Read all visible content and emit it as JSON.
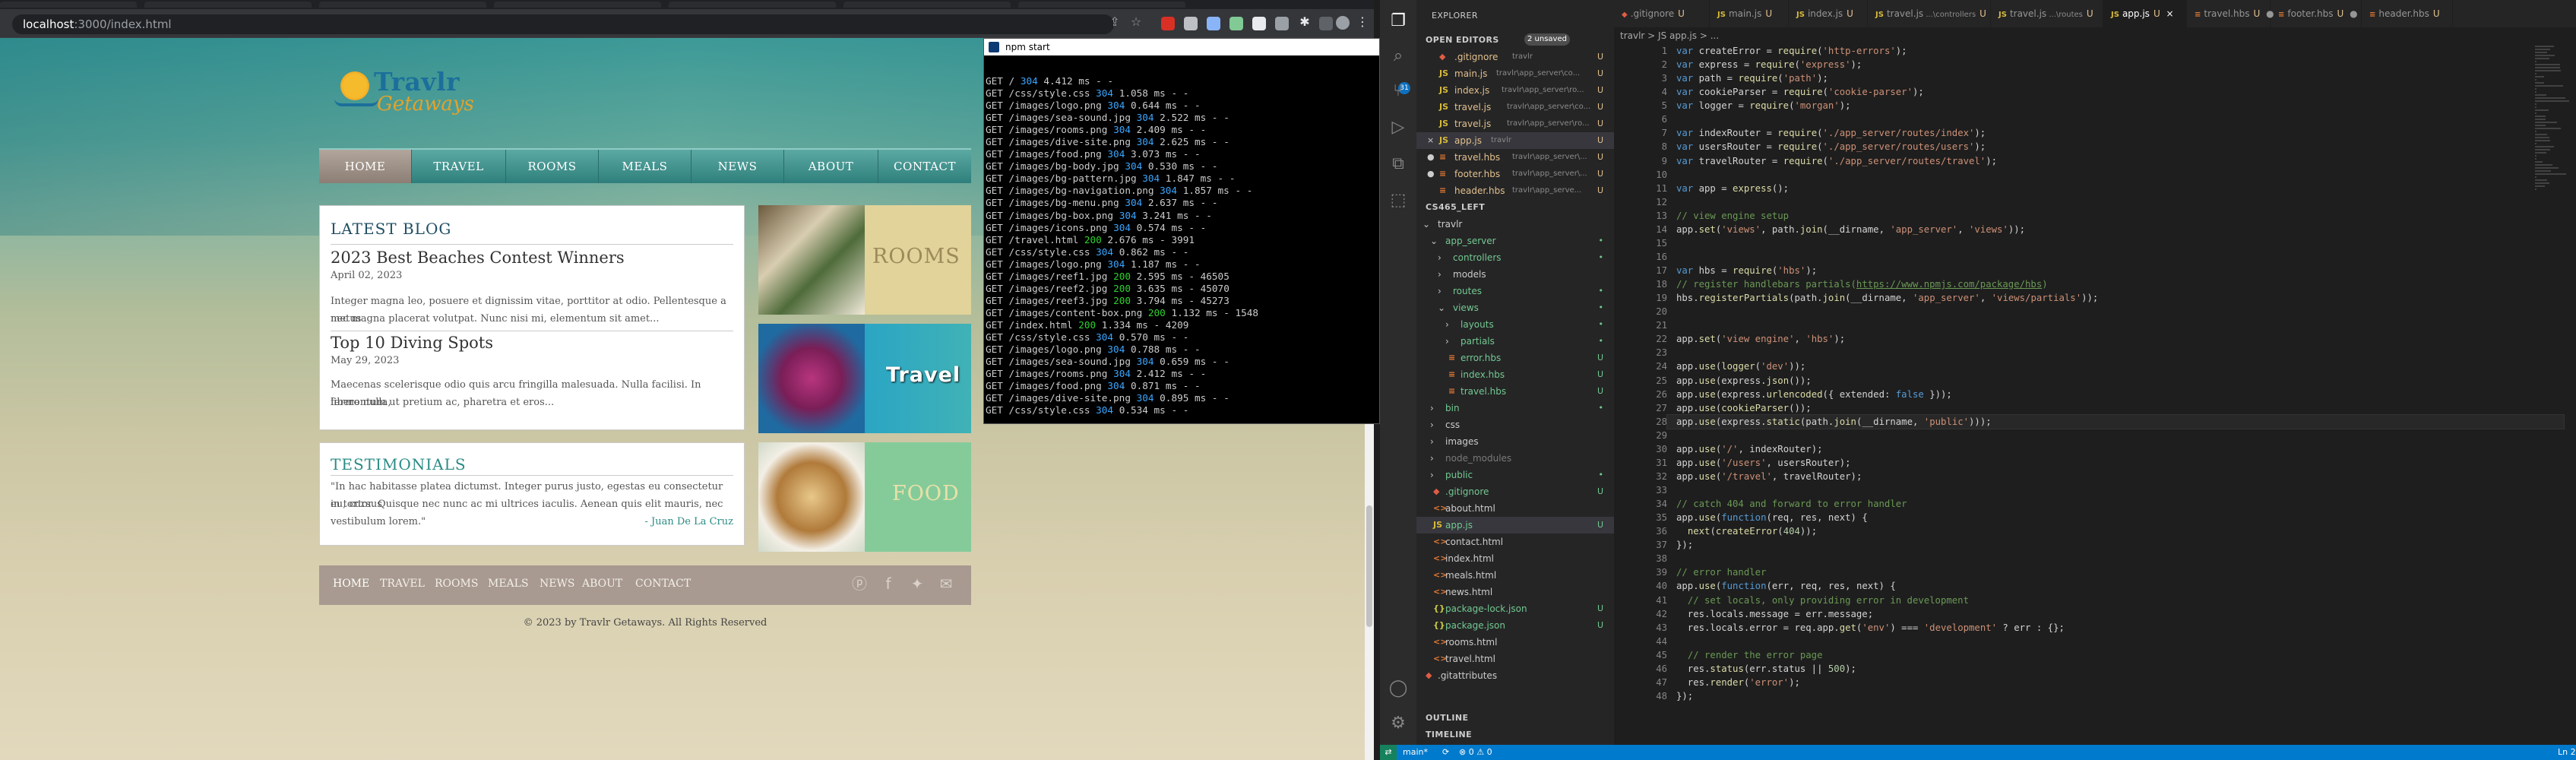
{
  "browser": {
    "url_host": "localhost",
    "url_path": ":3000/index.html"
  },
  "site": {
    "logo_word1": "Travlr",
    "logo_word2": "Getaways",
    "nav": [
      "HOME",
      "TRAVEL",
      "ROOMS",
      "MEALS",
      "NEWS",
      "ABOUT",
      "CONTACT"
    ],
    "nav_active": "HOME",
    "blog": {
      "heading": "LATEST BLOG",
      "posts": [
        {
          "title": "2023 Best Beaches Contest Winners",
          "date": "April 02, 2023",
          "body1": "Integer magna leo, posuere et dignissim vitae, porttitor at odio. Pellentesque a metus",
          "body2": "nec magna placerat volutpat. Nunc nisi mi, elementum sit amet..."
        },
        {
          "title": "Top 10 Diving Spots",
          "date": "May 29, 2023",
          "body1": "Maecenas scelerisque odio quis arcu fringilla malesuada. Nulla facilisi. In libero nulla,",
          "body2": "fermentum ut pretium ac, pharetra et eros..."
        }
      ]
    },
    "testimonials": {
      "heading": "TESTIMONIALS",
      "quote1": "\"In hac habitasse platea dictumst. Integer purus justo, egestas eu consectetur eu, cursus",
      "quote2": "in tortor. Quisque nec nunc ac mi ultrices iaculis. Aenean quis elit mauris, nec",
      "quote3": "vestibulum lorem.\"",
      "author": "- Juan De La Cruz"
    },
    "promos": [
      "ROOMS",
      "Travel",
      "FOOD"
    ],
    "footer_nav": [
      "HOME",
      "TRAVEL",
      "ROOMS",
      "MEALS",
      "NEWS",
      "ABOUT",
      "CONTACT"
    ],
    "copyright": "© 2023 by Travlr Getaways. All Rights Reserved"
  },
  "terminal": {
    "title": "npm start",
    "lines": [
      {
        "m": "GET",
        "p": "/",
        "c": "304",
        "t": "4.412 ms - -"
      },
      {
        "m": "GET",
        "p": "/css/style.css",
        "c": "304",
        "t": "1.058 ms - -"
      },
      {
        "m": "GET",
        "p": "/images/logo.png",
        "c": "304",
        "t": "0.644 ms - -"
      },
      {
        "m": "GET",
        "p": "/images/sea-sound.jpg",
        "c": "304",
        "t": "2.522 ms - -"
      },
      {
        "m": "GET",
        "p": "/images/rooms.png",
        "c": "304",
        "t": "2.409 ms - -"
      },
      {
        "m": "GET",
        "p": "/images/dive-site.png",
        "c": "304",
        "t": "2.625 ms - -"
      },
      {
        "m": "GET",
        "p": "/images/food.png",
        "c": "304",
        "t": "3.073 ms - -"
      },
      {
        "m": "GET",
        "p": "/images/bg-body.jpg",
        "c": "304",
        "t": "0.530 ms - -"
      },
      {
        "m": "GET",
        "p": "/images/bg-pattern.jpg",
        "c": "304",
        "t": "1.847 ms - -"
      },
      {
        "m": "GET",
        "p": "/images/bg-navigation.png",
        "c": "304",
        "t": "1.857 ms - -"
      },
      {
        "m": "GET",
        "p": "/images/bg-menu.png",
        "c": "304",
        "t": "2.637 ms - -"
      },
      {
        "m": "GET",
        "p": "/images/bg-box.png",
        "c": "304",
        "t": "3.241 ms - -"
      },
      {
        "m": "GET",
        "p": "/images/icons.png",
        "c": "304",
        "t": "0.574 ms - -"
      },
      {
        "m": "GET",
        "p": "/travel.html",
        "c": "200",
        "t": "2.676 ms - 3991"
      },
      {
        "m": "GET",
        "p": "/css/style.css",
        "c": "304",
        "t": "0.862 ms - -"
      },
      {
        "m": "GET",
        "p": "/images/logo.png",
        "c": "304",
        "t": "1.187 ms - -"
      },
      {
        "m": "GET",
        "p": "/images/reef1.jpg",
        "c": "200",
        "t": "2.595 ms - 46505"
      },
      {
        "m": "GET",
        "p": "/images/reef2.jpg",
        "c": "200",
        "t": "3.635 ms - 45070"
      },
      {
        "m": "GET",
        "p": "/images/reef3.jpg",
        "c": "200",
        "t": "3.794 ms - 45273"
      },
      {
        "m": "GET",
        "p": "/images/content-box.png",
        "c": "200",
        "t": "1.132 ms - 1548"
      },
      {
        "m": "GET",
        "p": "/index.html",
        "c": "200",
        "t": "1.334 ms - 4209"
      },
      {
        "m": "GET",
        "p": "/css/style.css",
        "c": "304",
        "t": "0.570 ms - -"
      },
      {
        "m": "GET",
        "p": "/images/logo.png",
        "c": "304",
        "t": "0.788 ms - -"
      },
      {
        "m": "GET",
        "p": "/images/sea-sound.jpg",
        "c": "304",
        "t": "0.659 ms - -"
      },
      {
        "m": "GET",
        "p": "/images/rooms.png",
        "c": "304",
        "t": "2.412 ms - -"
      },
      {
        "m": "GET",
        "p": "/images/food.png",
        "c": "304",
        "t": "0.871 ms - -"
      },
      {
        "m": "GET",
        "p": "/images/dive-site.png",
        "c": "304",
        "t": "0.895 ms - -"
      },
      {
        "m": "GET",
        "p": "/css/style.css",
        "c": "304",
        "t": "0.534 ms - -"
      }
    ]
  },
  "vscode": {
    "explorer_title": "EXPLORER",
    "open_editors_label": "OPEN EDITORS",
    "unsaved_badge": "2 unsaved",
    "open_editors": [
      {
        "icon": "git",
        "name": ".gitignore",
        "path": "travlr",
        "mark": "U"
      },
      {
        "icon": "JS",
        "name": "main.js",
        "path": "travlr\\app_server\\co...",
        "mark": "U"
      },
      {
        "icon": "JS",
        "name": "index.js",
        "path": "travlr\\app_server\\ro...",
        "mark": "U"
      },
      {
        "icon": "JS",
        "name": "travel.js",
        "path": "travlr\\app_server\\co...",
        "mark": "U"
      },
      {
        "icon": "JS",
        "name": "travel.js",
        "path": "travlr\\app_server\\ro...",
        "mark": "U"
      },
      {
        "icon": "JS",
        "name": "app.js",
        "path": "travlr",
        "mark": "U",
        "active": true
      },
      {
        "icon": "hbs",
        "name": "travel.hbs",
        "path": "travlr\\app_server\\...",
        "mark": "U",
        "dot": true
      },
      {
        "icon": "hbs",
        "name": "footer.hbs",
        "path": "travlr\\app_server\\...",
        "mark": "U",
        "dot": true
      },
      {
        "icon": "hbs",
        "name": "header.hbs",
        "path": "travlr\\app_serve...",
        "mark": "U"
      }
    ],
    "workspace_label": "CS465_LEFT",
    "tree": [
      {
        "d": 1,
        "t": "dir",
        "n": "travlr",
        "open": true
      },
      {
        "d": 2,
        "t": "dir",
        "n": "app_server",
        "open": true,
        "mark": "•"
      },
      {
        "d": 3,
        "t": "dir",
        "n": "controllers",
        "mark": "•"
      },
      {
        "d": 3,
        "t": "dir",
        "n": "models"
      },
      {
        "d": 3,
        "t": "dir",
        "n": "routes",
        "mark": "•"
      },
      {
        "d": 3,
        "t": "dir",
        "n": "views",
        "open": true,
        "mark": "•"
      },
      {
        "d": 4,
        "t": "dir",
        "n": "layouts",
        "mark": "•"
      },
      {
        "d": 4,
        "t": "dir",
        "n": "partials",
        "mark": "•"
      },
      {
        "d": 4,
        "t": "hbs",
        "n": "error.hbs",
        "mark": "U"
      },
      {
        "d": 4,
        "t": "hbs",
        "n": "index.hbs",
        "mark": "U"
      },
      {
        "d": 4,
        "t": "hbs",
        "n": "travel.hbs",
        "mark": "U"
      },
      {
        "d": 2,
        "t": "dir",
        "n": "bin",
        "mark": "•"
      },
      {
        "d": 2,
        "t": "dir",
        "n": "css"
      },
      {
        "d": 2,
        "t": "dir",
        "n": "images"
      },
      {
        "d": 2,
        "t": "dir",
        "n": "node_modules",
        "dim": true
      },
      {
        "d": 2,
        "t": "dir",
        "n": "public",
        "mark": "•"
      },
      {
        "d": 2,
        "t": "git",
        "n": ".gitignore",
        "mark": "U"
      },
      {
        "d": 2,
        "t": "html",
        "n": "about.html"
      },
      {
        "d": 2,
        "t": "JS",
        "n": "app.js",
        "mark": "U",
        "sel": true
      },
      {
        "d": 2,
        "t": "html",
        "n": "contact.html"
      },
      {
        "d": 2,
        "t": "html",
        "n": "index.html"
      },
      {
        "d": 2,
        "t": "html",
        "n": "meals.html"
      },
      {
        "d": 2,
        "t": "html",
        "n": "news.html"
      },
      {
        "d": 2,
        "t": "json",
        "n": "package-lock.json",
        "mark": "U"
      },
      {
        "d": 2,
        "t": "json",
        "n": "package.json",
        "mark": "U"
      },
      {
        "d": 2,
        "t": "html",
        "n": "rooms.html"
      },
      {
        "d": 2,
        "t": "html",
        "n": "travel.html"
      },
      {
        "d": 1,
        "t": "git",
        "n": ".gitattributes"
      }
    ],
    "outline_label": "OUTLINE",
    "timeline_label": "TIMELINE",
    "tabs": [
      {
        "kind": "git",
        "name": ".gitignore",
        "mark": "U"
      },
      {
        "kind": "JS",
        "name": "main.js",
        "mark": "U"
      },
      {
        "kind": "JS",
        "name": "index.js",
        "mark": "U"
      },
      {
        "kind": "JS",
        "name": "travel.js",
        "sub": "...\\controllers",
        "mark": "U"
      },
      {
        "kind": "JS",
        "name": "travel.js",
        "sub": "...\\routes",
        "mark": "U"
      },
      {
        "kind": "JS",
        "name": "app.js",
        "mark": "U",
        "active": true
      },
      {
        "kind": "hbs",
        "name": "travel.hbs",
        "mark": "U",
        "dot": true
      },
      {
        "kind": "hbs",
        "name": "footer.hbs",
        "mark": "U",
        "dot": true
      },
      {
        "kind": "hbs",
        "name": "header.hbs",
        "mark": "U"
      }
    ],
    "breadcrumb": "travlr > JS app.js > ...",
    "current_line": 28,
    "code": [
      "var createError = require('http-errors');",
      "var express = require('express');",
      "var path = require('path');",
      "var cookieParser = require('cookie-parser');",
      "var logger = require('morgan');",
      "",
      "var indexRouter = require('./app_server/routes/index');",
      "var usersRouter = require('./app_server/routes/users');",
      "var travelRouter = require('./app_server/routes/travel');",
      "",
      "var app = express();",
      "",
      "// view engine setup",
      "app.set('views', path.join(__dirname, 'app_server', 'views'));",
      "",
      "",
      "var hbs = require('hbs');",
      "// register handlebars partials(https://www.npmjs.com/package/hbs)",
      "hbs.registerPartials(path.join(__dirname, 'app_server', 'views/partials'));",
      "",
      "",
      "app.set('view engine', 'hbs');",
      "",
      "app.use(logger('dev'));",
      "app.use(express.json());",
      "app.use(express.urlencoded({ extended: false }));",
      "app.use(cookieParser());",
      "app.use(express.static(path.join(__dirname, 'public')));",
      "",
      "app.use('/', indexRouter);",
      "app.use('/users', usersRouter);",
      "app.use('/travel', travelRouter);",
      "",
      "// catch 404 and forward to error handler",
      "app.use(function(req, res, next) {",
      "  next(createError(404));",
      "});",
      "",
      "// error handler",
      "app.use(function(err, req, res, next) {",
      "  // set locals, only providing error in development",
      "  res.locals.message = err.message;",
      "  res.locals.error = req.app.get('env') === 'development' ? err : {};",
      "",
      "  // render the error page",
      "  res.status(err.status || 500);",
      "  res.render('error');",
      "});"
    ],
    "status": {
      "branch": "main*",
      "problems": "⊗ 0 ⚠ 0",
      "right": "Ln 2"
    }
  },
  "colors": {
    "teal_heading": "#2a8c85",
    "blog_heading": "#1f4e63",
    "vscode_blue": "#007acc"
  }
}
